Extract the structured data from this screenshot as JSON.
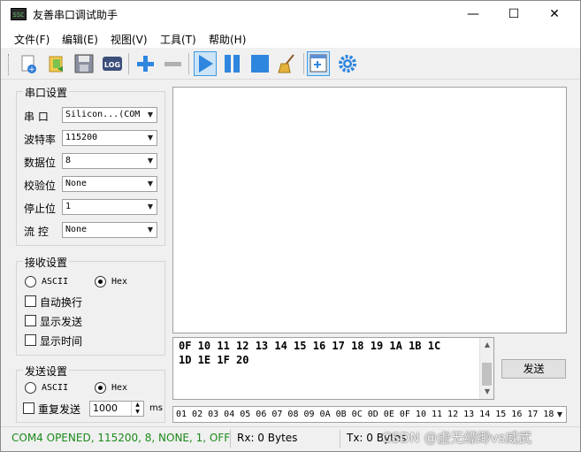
{
  "window": {
    "app_icon_text": "SSC",
    "title": "友善串口调试助手",
    "minimize": "—",
    "maximize": "☐",
    "close": "✕"
  },
  "menu": [
    "文件(F)",
    "编辑(E)",
    "视图(V)",
    "工具(T)",
    "帮助(H)"
  ],
  "toolbar": {
    "log_label": "LOG",
    "icons": [
      "new-file-icon",
      "open-folder-icon",
      "save-icon",
      "log-icon",
      "add-icon",
      "remove-icon",
      "play-icon",
      "pause-icon",
      "stop-icon",
      "broom-icon",
      "window-icon",
      "settings-gear-icon"
    ]
  },
  "serial_settings": {
    "title": "串口设置",
    "port_label": "串  口",
    "port_value": "Silicon...(COM",
    "baud_label": "波特率",
    "baud_value": "115200",
    "data_bits_label": "数据位",
    "data_bits_value": "8",
    "parity_label": "校验位",
    "parity_value": "None",
    "stop_bits_label": "停止位",
    "stop_bits_value": "1",
    "flow_label": "流  控",
    "flow_value": "None"
  },
  "receive_settings": {
    "title": "接收设置",
    "ascii_label": "ASCII",
    "hex_label": "Hex",
    "selected": "Hex",
    "auto_wrap_label": "自动换行",
    "show_send_label": "显示发送",
    "show_time_label": "显示时间"
  },
  "send_settings": {
    "title": "发送设置",
    "ascii_label": "ASCII",
    "hex_label": "Hex",
    "selected": "Hex",
    "repeat_label": "重复发送",
    "interval_value": "1000",
    "interval_unit": "ms"
  },
  "send_area": {
    "line1": "0F 10 11 12 13 14 15 16 17 18 19 1A 1B 1C",
    "line2": "1D 1E 1F 20",
    "send_button": "发送",
    "history_value": "01 02 03 04 05 06 07 08 09 0A 0B 0C 0D 0E 0F 10 11 12 13 14 15 16 17 18"
  },
  "status": {
    "connection": "COM4 OPENED, 115200, 8, NONE, 1, OFF",
    "rx": "Rx: 0 Bytes",
    "tx": "Tx: 0 Bytes",
    "watermark": "CSDN @虚无缥缈vs威武"
  },
  "colors": {
    "status_green": "#1a8a1a",
    "accent_blue": "#2e86de"
  }
}
